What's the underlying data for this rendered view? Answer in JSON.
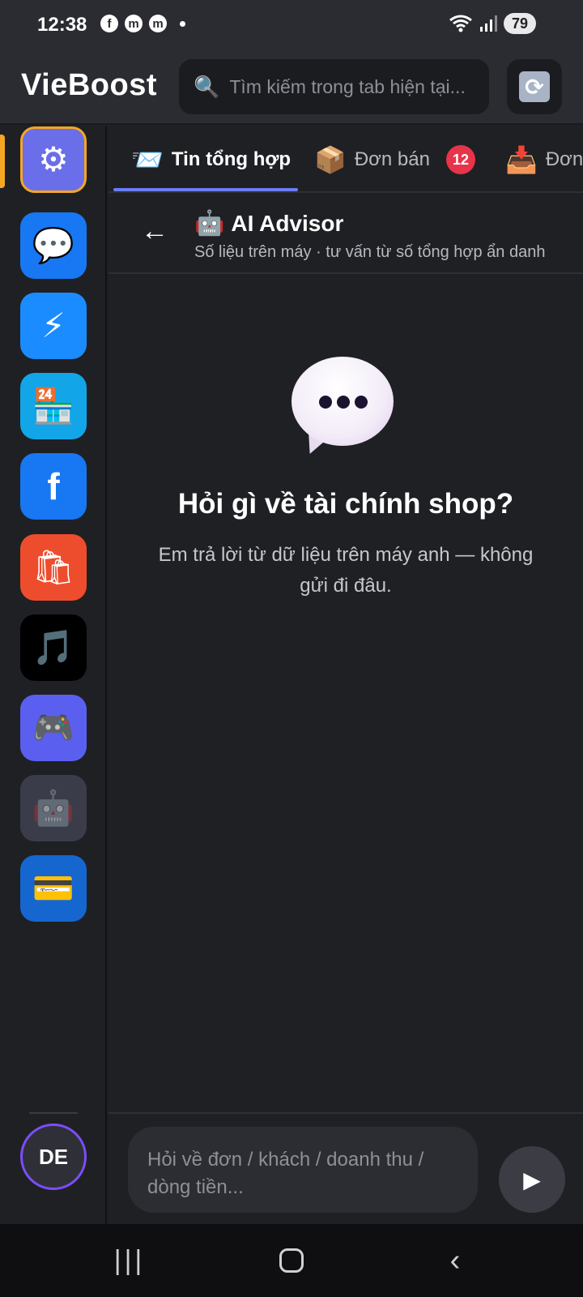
{
  "status_bar": {
    "time": "12:38",
    "app_icons": [
      "f",
      "m",
      "m"
    ],
    "battery": "79"
  },
  "header": {
    "title": "VieBoost",
    "search_placeholder": "Tìm kiếm trong tab hiện tại..."
  },
  "sidebar": {
    "items": [
      {
        "name": "hub-icon",
        "glyph": "⚙",
        "bg": "#6a6ee8"
      },
      {
        "name": "messenger-icon",
        "glyph": "💬",
        "bg": "#1877f2"
      },
      {
        "name": "lightning-icon",
        "glyph": "⚡",
        "bg": "#1b8cff"
      },
      {
        "name": "store-24-icon",
        "glyph": "🏪",
        "bg": "#12a6e8"
      },
      {
        "name": "facebook-icon",
        "glyph": "f",
        "bg": "#1877f2"
      },
      {
        "name": "shopping-bags-icon",
        "glyph": "🛍",
        "bg": "#ee4d2d"
      },
      {
        "name": "music-note-icon",
        "glyph": "🎵",
        "bg": "#000000"
      },
      {
        "name": "gamepad-icon",
        "glyph": "🎮",
        "bg": "#5b5ff0"
      },
      {
        "name": "robot-icon",
        "glyph": "🤖",
        "bg": "#3a3c4a"
      },
      {
        "name": "credit-card-icon",
        "glyph": "💳",
        "bg": "#1666d0"
      }
    ],
    "avatar": "DE"
  },
  "tabs": [
    {
      "icon": "📨",
      "label": "Tin tổng hợp",
      "active": true
    },
    {
      "icon": "📦",
      "label": "Đơn bán",
      "badge": "12"
    },
    {
      "icon": "📥",
      "label": "Đơn"
    }
  ],
  "advisor": {
    "icon": "🤖",
    "title": "AI Advisor",
    "subtitle": "Số liệu trên máy · tư vấn từ số tổng hợp ẩn danh"
  },
  "empty_state": {
    "title": "Hỏi gì về tài chính shop?",
    "description": "Em trả lời từ dữ liệu trên máy anh — không gửi đi đâu."
  },
  "composer": {
    "placeholder": "Hỏi về đơn / khách / doanh thu / dòng tiền..."
  },
  "colors": {
    "accent": "#f5a623",
    "tab_underline": "#6c7cf5",
    "badge": "#e8344a",
    "avatar_ring": "#7c4dff"
  }
}
